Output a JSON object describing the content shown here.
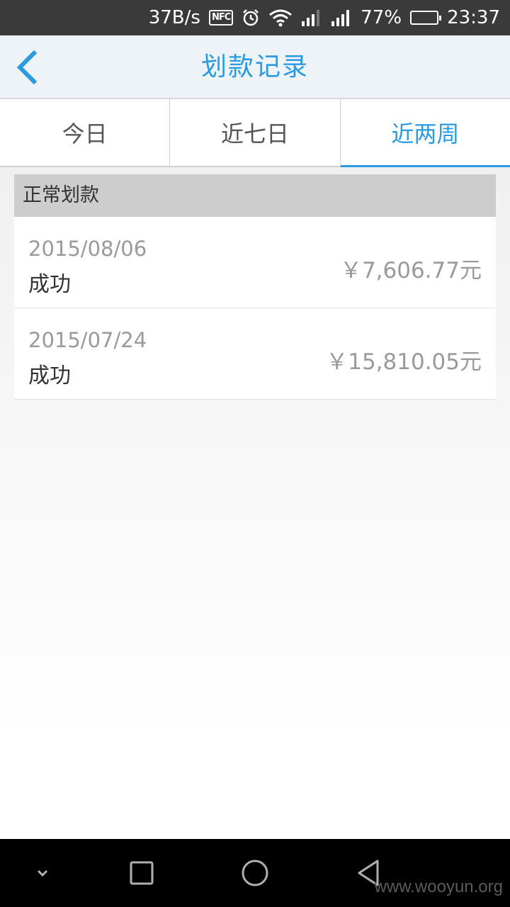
{
  "status_bar": {
    "net_speed": "37B/s",
    "nfc": "NFC",
    "battery_percent": "77%",
    "battery_level": 0.77,
    "time": "23:37"
  },
  "title_bar": {
    "title": "划款记录"
  },
  "tabs": [
    {
      "label": "今日",
      "active": false
    },
    {
      "label": "近七日",
      "active": false
    },
    {
      "label": "近两周",
      "active": true
    }
  ],
  "section": {
    "header": "正常划款",
    "records": [
      {
        "date": "2015/08/06",
        "status": "成功",
        "amount": "￥7,606.77元"
      },
      {
        "date": "2015/07/24",
        "status": "成功",
        "amount": "￥15,810.05元"
      }
    ]
  },
  "watermark": "www.wooyun.org",
  "colors": {
    "accent": "#2b9be0",
    "status_bar_bg": "#3a3a3a",
    "title_bar_bg": "#eef3f7",
    "section_header_bg": "#cdcdcd"
  }
}
